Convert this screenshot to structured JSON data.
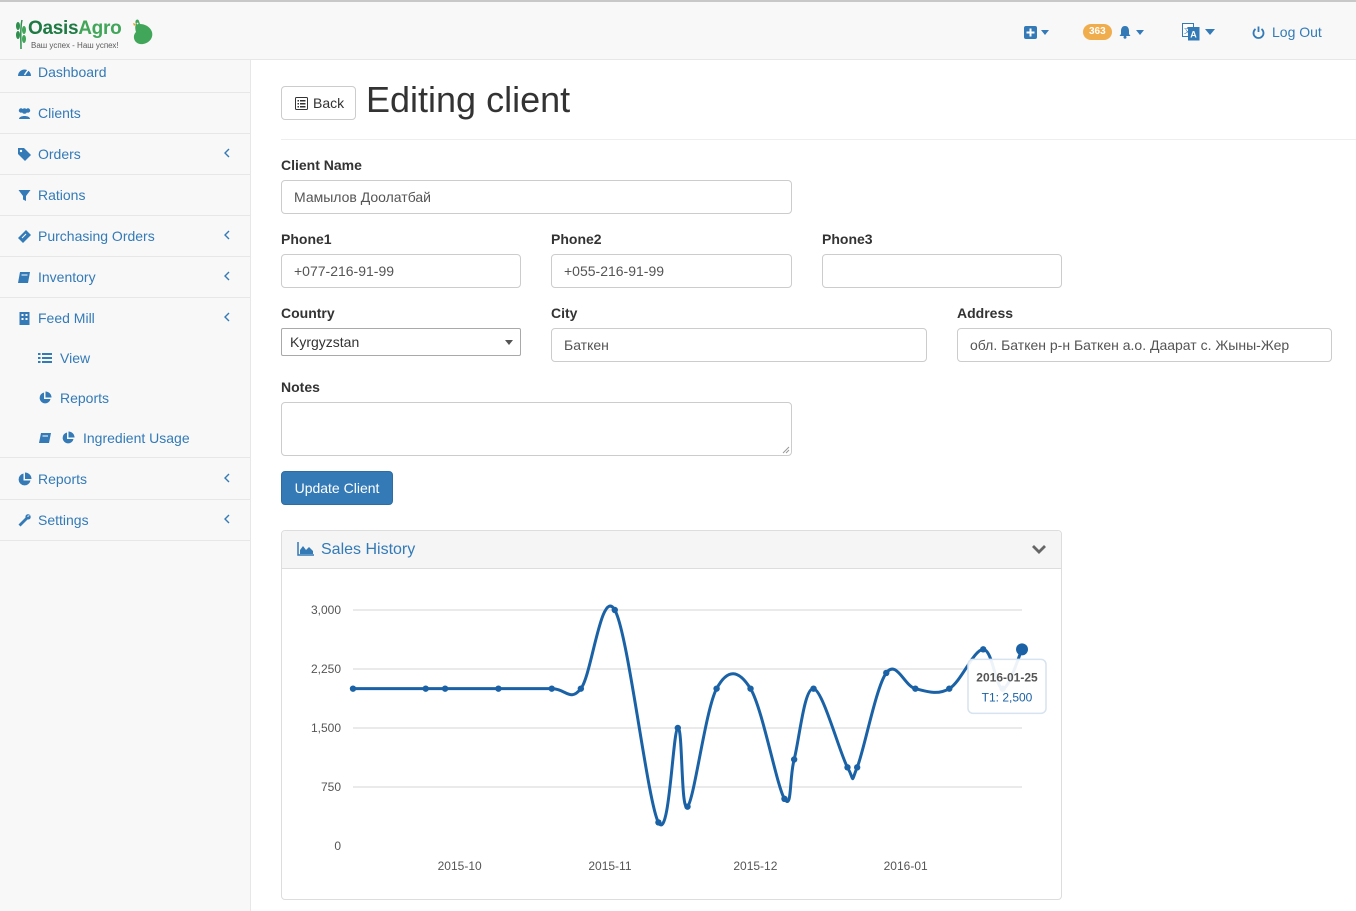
{
  "brand": {
    "name_part1": "Oasis",
    "name_part2": "Agro",
    "slogan": "Ваш успех - Наш успех!"
  },
  "topnav": {
    "notification_count": "363",
    "logout_label": "Log Out"
  },
  "sidebar": {
    "items": [
      {
        "label": "Dashboard",
        "icon": "dashboard-icon",
        "has_submenu": false
      },
      {
        "label": "Clients",
        "icon": "users-icon",
        "has_submenu": false
      },
      {
        "label": "Orders",
        "icon": "tags-icon",
        "has_submenu": true
      },
      {
        "label": "Rations",
        "icon": "filter-icon",
        "has_submenu": false
      },
      {
        "label": "Purchasing Orders",
        "icon": "ticket-icon",
        "has_submenu": true
      },
      {
        "label": "Inventory",
        "icon": "book-icon",
        "has_submenu": true
      },
      {
        "label": "Feed Mill",
        "icon": "building-icon",
        "has_submenu": true,
        "expanded": true
      },
      {
        "label": "Reports",
        "icon": "pie-chart-icon",
        "has_submenu": true
      },
      {
        "label": "Settings",
        "icon": "wrench-icon",
        "has_submenu": true
      }
    ],
    "feed_mill_sub": [
      {
        "label": "View",
        "icon": "list-icon"
      },
      {
        "label": "Reports",
        "icon": "pie-chart-icon"
      },
      {
        "label": "Ingredient Usage",
        "icon": "book-pie-icon"
      }
    ]
  },
  "page": {
    "back_label": "Back",
    "title": "Editing client"
  },
  "form": {
    "client_name": {
      "label": "Client Name",
      "value": "Мамылов Доолатбай"
    },
    "phone1": {
      "label": "Phone1",
      "value": "+077-216-91-99"
    },
    "phone2": {
      "label": "Phone2",
      "value": "+055-216-91-99"
    },
    "phone3": {
      "label": "Phone3",
      "value": ""
    },
    "country": {
      "label": "Country",
      "value": "Kyrgyzstan"
    },
    "city": {
      "label": "City",
      "value": "Баткен"
    },
    "address": {
      "label": "Address",
      "value": "обл. Баткен р-н Баткен а.о. Даарат с. Жыны-Жер"
    },
    "notes": {
      "label": "Notes",
      "value": ""
    },
    "submit_label": "Update Client"
  },
  "sales_panel": {
    "title": "Sales History"
  },
  "chart_data": {
    "type": "line",
    "title": "",
    "x": [
      "2015-09-09",
      "2015-09-24",
      "2015-09-28",
      "2015-10-09",
      "2015-10-20",
      "2015-10-26",
      "2015-11-02",
      "2015-11-11",
      "2015-11-15",
      "2015-11-17",
      "2015-11-23",
      "2015-11-30",
      "2015-12-07",
      "2015-12-09",
      "2015-12-13",
      "2015-12-20",
      "2015-12-22",
      "2015-12-28",
      "2016-01-03",
      "2016-01-10",
      "2016-01-17",
      "2016-01-21",
      "2016-01-25"
    ],
    "series": [
      {
        "name": "T1",
        "color": "#1a62a5",
        "values": [
          2000,
          2000,
          2000,
          2000,
          2000,
          2000,
          3000,
          300,
          1500,
          500,
          2000,
          2000,
          600,
          1100,
          2000,
          1000,
          1000,
          2200,
          2000,
          2000,
          2500,
          2000,
          2500
        ]
      }
    ],
    "xticks": [
      "2015-10",
      "2015-11",
      "2015-12",
      "2016-01"
    ],
    "yticks": [
      "0",
      "750",
      "1,500",
      "2,250",
      "3,000"
    ],
    "ylim": [
      0,
      3000
    ],
    "grid": true,
    "tooltip": {
      "date": "2016-01-25",
      "text": "T1: 2,500"
    }
  }
}
